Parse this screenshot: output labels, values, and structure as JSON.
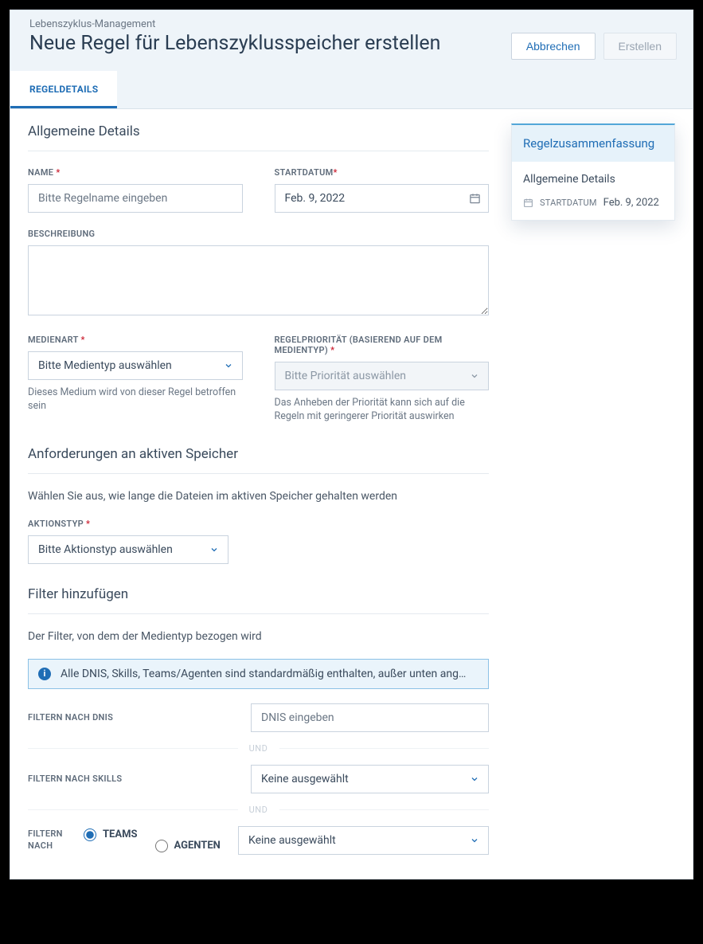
{
  "header": {
    "breadcrumb": "Lebenszyklus-Management",
    "title": "Neue Regel für Lebenszyklusspeicher erstellen",
    "cancel": "Abbrechen",
    "create": "Erstellen"
  },
  "tabs": {
    "details": "REGELDETAILS"
  },
  "sections": {
    "general": "Allgemeine Details",
    "active": "Anforderungen an aktiven Speicher",
    "filters": "Filter hinzufügen"
  },
  "fields": {
    "name_label": "NAME",
    "name_placeholder": "Bitte Regelname eingeben",
    "startdate_label": "STARTDATUM",
    "startdate_value": "Feb. 9, 2022",
    "description_label": "BESCHREIBUNG",
    "media_label": "MEDIENART",
    "media_placeholder": "Bitte Medientyp auswählen",
    "media_helper": "Dieses Medium wird von dieser Regel betroffen sein",
    "priority_label": "REGELPRIORITÄT (BASIEREND AUF DEM MEDIENTYP)",
    "priority_placeholder": "Bitte Priorität auswählen",
    "priority_helper": "Das Anheben der Priorität kann sich auf die Regeln mit geringerer Priorität auswirken",
    "active_desc": "Wählen Sie aus, wie lange die Dateien im aktiven Speicher gehalten werden",
    "action_label": "AKTIONSTYP",
    "action_placeholder": "Bitte Aktionstyp auswählen",
    "filters_desc": "Der Filter, von dem der Medientyp bezogen wird",
    "info_text": "Alle DNIS, Skills, Teams/Agenten sind standardmäßig enthalten, außer unten ang…",
    "filter_dnis_label": "FILTERN NACH DNIS",
    "filter_dnis_placeholder": "DNIS eingeben",
    "and": "UND",
    "filter_skills_label": "FILTERN NACH SKILLS",
    "none_selected": "Keine ausgewählt",
    "filter_by_label": "FILTERN NACH",
    "teams": "TEAMS",
    "agents": "AGENTEN"
  },
  "summary": {
    "title": "Regelzusammenfassung",
    "section": "Allgemeine Details",
    "startdate_key": "STARTDATUM",
    "startdate_val": "Feb. 9, 2022"
  }
}
